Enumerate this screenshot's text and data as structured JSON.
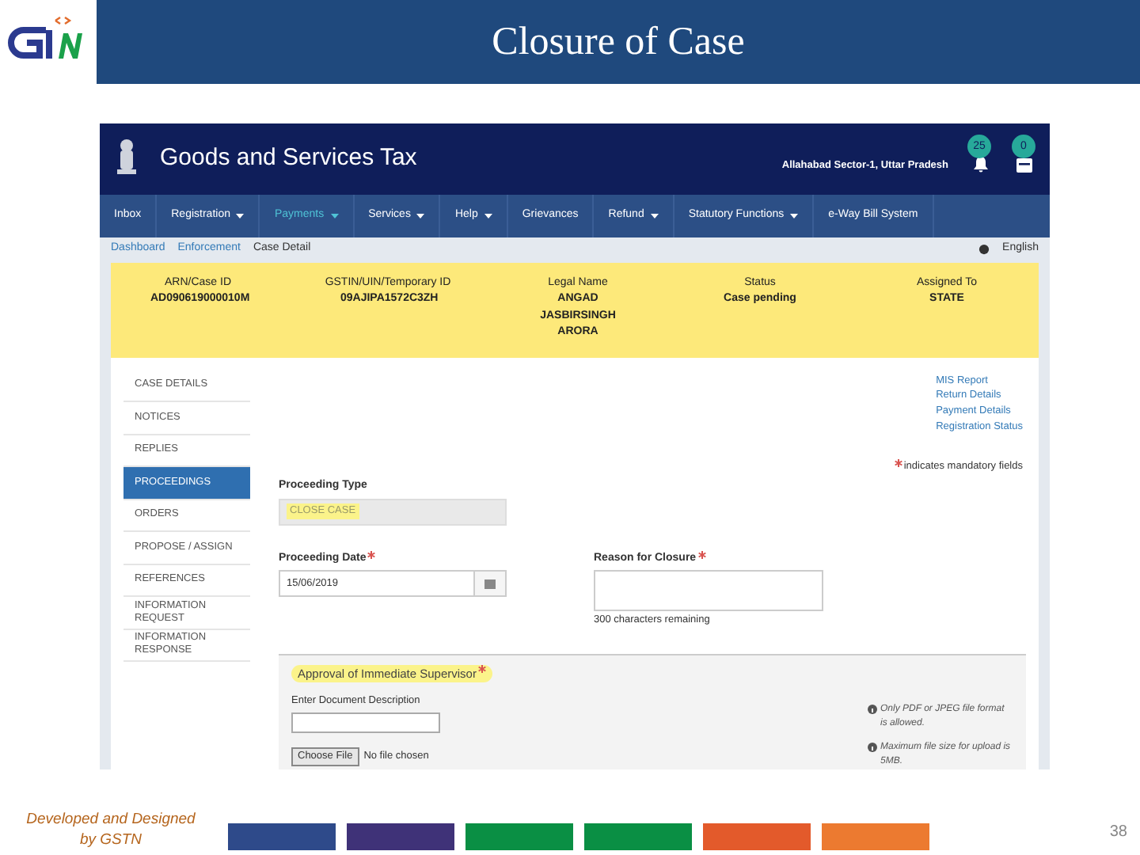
{
  "slide": {
    "title": "Closure of Case",
    "footer": "Developed and Designed by GSTN",
    "page_number": "38",
    "color_bars": [
      {
        "color": "#2e4a8a"
      },
      {
        "color": "#3f3278"
      },
      {
        "color": "#0a8f44"
      },
      {
        "color": "#0a8f44"
      },
      {
        "color": "#e35a2b"
      },
      {
        "color": "#ec7a30"
      }
    ]
  },
  "app": {
    "title": "Goods and Services Tax",
    "location": "Allahabad Sector-1, Uttar Pradesh",
    "notifications": [
      {
        "kind": "bell",
        "count": "25"
      },
      {
        "kind": "inbox",
        "count": "0"
      }
    ],
    "nav": [
      {
        "label": "Inbox",
        "has_menu": false,
        "selected": false
      },
      {
        "label": "Registration",
        "has_menu": true,
        "selected": false
      },
      {
        "label": "Payments",
        "has_menu": true,
        "selected": true
      },
      {
        "label": "Services",
        "has_menu": true,
        "selected": false
      },
      {
        "label": "Help",
        "has_menu": true,
        "selected": false
      },
      {
        "label": "Grievances",
        "has_menu": false,
        "selected": false
      },
      {
        "label": "Refund",
        "has_menu": true,
        "selected": false
      },
      {
        "label": "Statutory Functions",
        "has_menu": true,
        "selected": false
      },
      {
        "label": "e-Way Bill System",
        "has_menu": false,
        "selected": false
      }
    ],
    "breadcrumb": [
      "Dashboard",
      "Enforcement",
      "Case Detail"
    ],
    "language": "English",
    "case_summary": [
      {
        "label": "ARN/Case ID",
        "value": "AD090619000010M"
      },
      {
        "label": "GSTIN/UIN/Temporary ID",
        "value": "09AJIPA1572C3ZH"
      },
      {
        "label": "Legal Name",
        "value": "ANGAD JASBIRSINGH ARORA"
      },
      {
        "label": "Status",
        "value": "Case pending"
      },
      {
        "label": "Assigned To",
        "value": "STATE"
      }
    ],
    "sidebar": [
      {
        "label": "CASE DETAILS",
        "selected": false
      },
      {
        "label": "NOTICES",
        "selected": false
      },
      {
        "label": "REPLIES",
        "selected": false
      },
      {
        "label": "PROCEEDINGS",
        "selected": true
      },
      {
        "label": "ORDERS",
        "selected": false
      },
      {
        "label": "PROPOSE / ASSIGN",
        "selected": false
      },
      {
        "label": "REFERENCES",
        "selected": false
      },
      {
        "label": "INFORMATION REQUEST",
        "selected": false
      },
      {
        "label": "INFORMATION RESPONSE",
        "selected": false
      }
    ],
    "links": [
      "MIS Report",
      "Return Details",
      "Payment Details",
      "Registration Status"
    ],
    "mandatory_note": "indicates mandatory fields",
    "form": {
      "proceeding_type": {
        "label": "Proceeding Type",
        "value": "CLOSE CASE"
      },
      "proceeding_date": {
        "label": "Proceeding Date",
        "value": "15/06/2019",
        "required": true
      },
      "reason": {
        "label": "Reason for Closure",
        "counter": "300 characters remaining",
        "required": true
      },
      "approval": {
        "heading": "Approval of Immediate Supervisor",
        "required": true,
        "description_label": "Enter Document Description",
        "choose_file": "Choose File",
        "no_file": "No file chosen",
        "notes": [
          "Only PDF or JPEG file format is allowed.",
          "Maximum file size for upload is 5MB."
        ]
      }
    }
  }
}
